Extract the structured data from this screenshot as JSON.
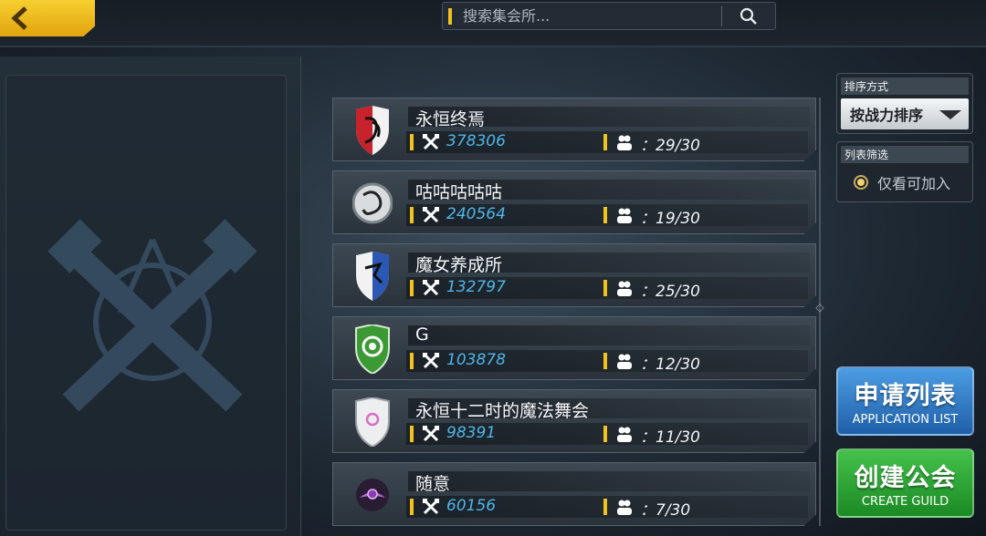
{
  "search": {
    "placeholder": "搜索集会所..."
  },
  "sort": {
    "title": "排序方式",
    "selected": "按战力排序"
  },
  "filter": {
    "title": "列表筛选",
    "option_label": "仅看可加入",
    "checked": true
  },
  "guilds": [
    {
      "name": "永恒终焉",
      "power": "378306",
      "members": "：29/30",
      "icon": "red-white-shield-emblem-icon",
      "color": "#c8222d"
    },
    {
      "name": "咕咕咕咕咕",
      "power": "240564",
      "members": "：19/30",
      "icon": "grey-round-dragon-emblem-icon",
      "color": "#9aa0a5"
    },
    {
      "name": "魔女养成所",
      "power": "132797",
      "members": "：25/30",
      "icon": "blue-white-shield-emblem-icon",
      "color": "#2b57b5"
    },
    {
      "name": "G",
      "power": "103878",
      "members": "：12/30",
      "icon": "green-lion-shield-emblem-icon",
      "color": "#3c9a35"
    },
    {
      "name": "永恒十二时的魔法舞会",
      "power": "98391",
      "members": "：11/30",
      "icon": "white-shield-emblem-icon",
      "color": "#e8e8ea"
    },
    {
      "name": "随意",
      "power": "60156",
      "members": "：7/30",
      "icon": "purple-wing-emblem-icon",
      "color": "#8a3bb3"
    }
  ],
  "buttons": {
    "apply_cn": "申请列表",
    "apply_en": "APPLICATION LIST",
    "create_cn": "创建公会",
    "create_en": "CREATE GUILD"
  },
  "colors": {
    "accent_yellow": "#f2c21c",
    "power_blue": "#4fb5e8",
    "apply_blue": "#2f78c6",
    "create_green": "#2ea533"
  }
}
